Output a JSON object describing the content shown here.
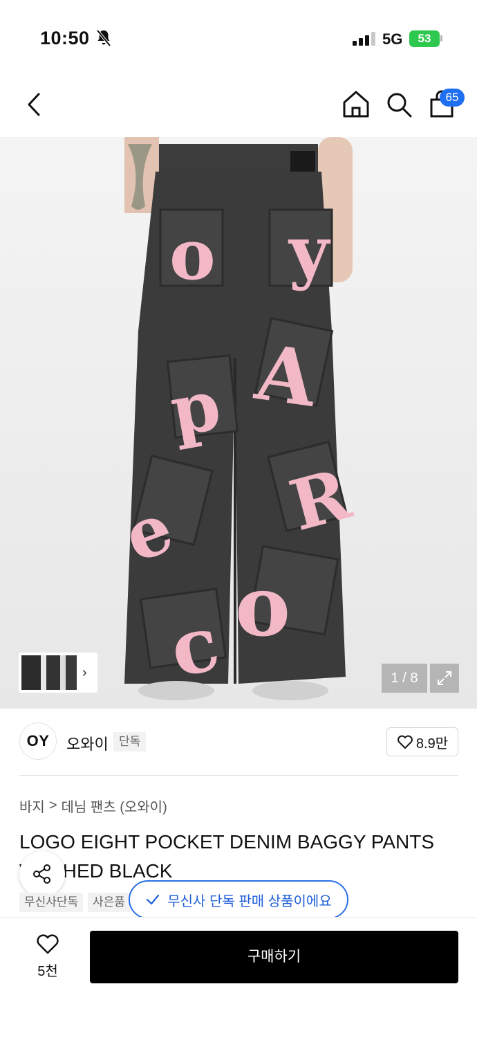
{
  "status_bar": {
    "time": "10:50",
    "network": "5G",
    "battery": "53"
  },
  "header": {
    "cart_count": "65"
  },
  "gallery": {
    "page_indicator": "1 / 8"
  },
  "brand": {
    "logo_text": "OY",
    "name": "오와이",
    "tag": "단독",
    "likes": "8.9만"
  },
  "breadcrumb": {
    "category": "바지",
    "separator": ">",
    "subcategory": "데님 팬츠 (오와이)"
  },
  "product": {
    "title": "LOGO EIGHT POCKET DENIM BAGGY PANTS WASHED BLACK"
  },
  "tags": [
    "무신사단독",
    "사은품"
  ],
  "toast": {
    "text": "무신사 단독 판매 상품이에요"
  },
  "bottom_bar": {
    "wish_count": "5천",
    "buy_label": "구매하기"
  },
  "colors": {
    "accent_blue": "#1f6ff2",
    "battery_green": "#2dc84d",
    "pants_pink": "#f2b8c6",
    "denim_black": "#3a3a3a"
  }
}
